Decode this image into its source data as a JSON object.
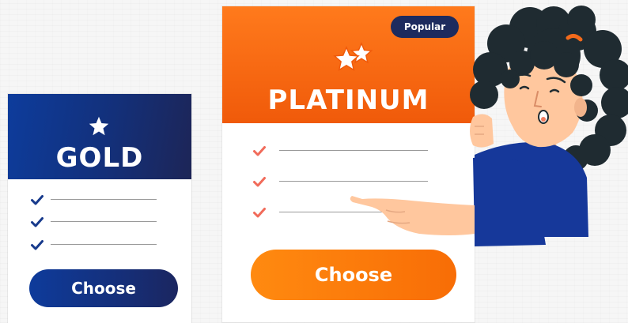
{
  "colors": {
    "gold_header": "#13307a",
    "gold_check": "#173a8c",
    "platinum_header": "#f56a10",
    "platinum_check": "#f16b5a",
    "badge_bg": "#1d2b5e",
    "button_orange": "#fb7a0c",
    "button_blue": "#152f7a",
    "shirt": "#16389a",
    "hair": "#1f2b31",
    "skin": "#ffc79e"
  },
  "gold": {
    "icon": "star-icon",
    "title": "GOLD",
    "features": [
      {
        "icon": "check-icon"
      },
      {
        "icon": "check-icon"
      },
      {
        "icon": "check-icon"
      }
    ],
    "button": "Choose"
  },
  "platinum": {
    "badge": "Popular",
    "icon": "two-stars-icon",
    "title": "PLATINUM",
    "features": [
      {
        "icon": "check-icon"
      },
      {
        "icon": "check-icon"
      },
      {
        "icon": "check-icon"
      }
    ],
    "button": "Choose"
  }
}
